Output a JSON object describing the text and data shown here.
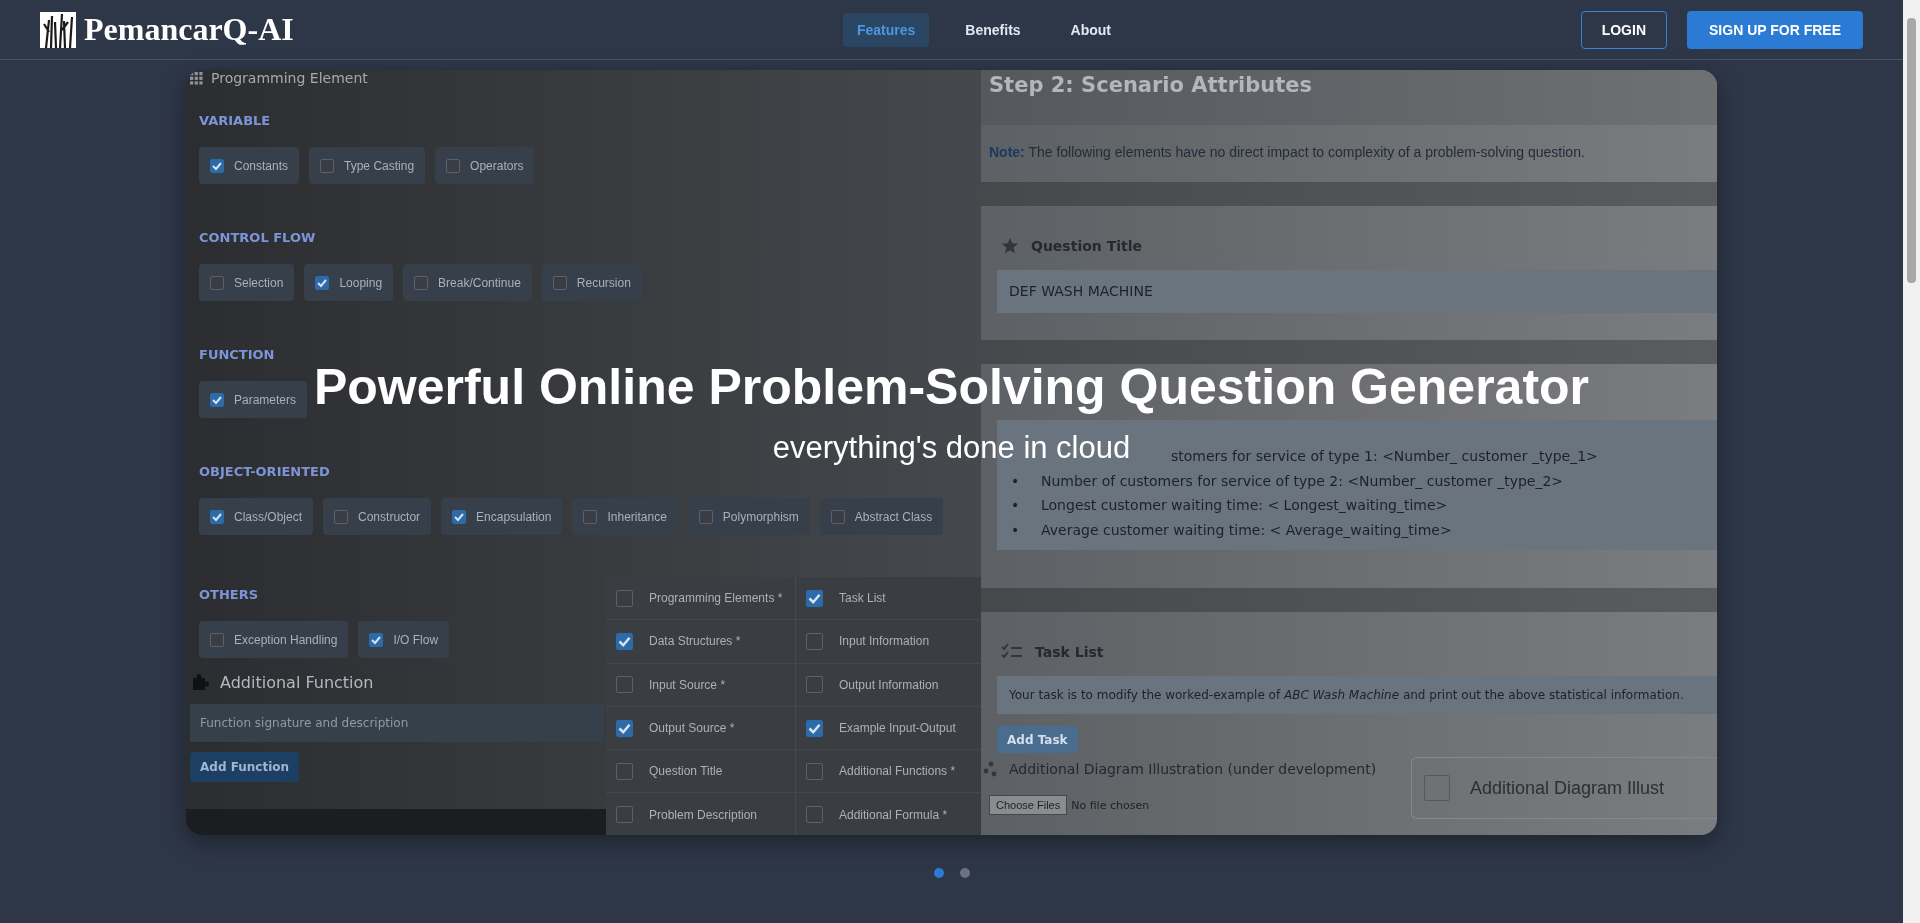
{
  "header": {
    "logo": "PemancarQ-AI",
    "nav": [
      {
        "label": "Features",
        "selected": true
      },
      {
        "label": "Benefits",
        "selected": false
      },
      {
        "label": "About",
        "selected": false
      }
    ],
    "buttons": [
      {
        "label": "LOGIN",
        "kind": "outline"
      },
      {
        "label": "SIGN UP FOR FREE",
        "kind": "primary"
      }
    ]
  },
  "hero": {
    "headline": "Powerful Online Problem-Solving Question Generator",
    "subtitle": "everything's done in cloud",
    "slides": [
      {
        "selected": true
      },
      {
        "selected": false
      }
    ],
    "screenshot": {
      "left_panel": {
        "title": "Programming Element",
        "groups": [
          {
            "heading": "VARIABLE",
            "options": [
              {
                "label": "Constants",
                "checked": true
              },
              {
                "label": "Type Casting",
                "checked": false
              },
              {
                "label": "Operators",
                "checked": false
              }
            ]
          },
          {
            "heading": "CONTROL FLOW",
            "options": [
              {
                "label": "Selection",
                "checked": false
              },
              {
                "label": "Looping",
                "checked": true
              },
              {
                "label": "Break/Continue",
                "checked": false
              },
              {
                "label": "Recursion",
                "checked": false
              }
            ]
          },
          {
            "heading": "FUNCTION",
            "options": [
              {
                "label": "Parameters",
                "checked": true
              }
            ]
          },
          {
            "heading": "OBJECT-ORIENTED",
            "options": [
              {
                "label": "Class/Object",
                "checked": true
              },
              {
                "label": "Constructor",
                "checked": false
              },
              {
                "label": "Encapsulation",
                "checked": true
              },
              {
                "label": "Inheritance",
                "checked": false
              },
              {
                "label": "Polymorphism",
                "checked": false
              },
              {
                "label": "Abstract Class",
                "checked": false
              }
            ]
          },
          {
            "heading": "OTHERS",
            "options": [
              {
                "label": "Exception Handling",
                "checked": false
              },
              {
                "label": "I/O Flow",
                "checked": true
              }
            ]
          }
        ],
        "additional_function": {
          "heading": "Additional Function",
          "placeholder": "Function signature and description",
          "button": "Add Function"
        }
      },
      "checklist": [
        [
          {
            "label": "Programming Elements *",
            "checked": false
          },
          {
            "label": "Data Structures *",
            "checked": true
          },
          {
            "label": "Input Source *",
            "checked": false
          },
          {
            "label": "Output Source *",
            "checked": true
          },
          {
            "label": "Question Title",
            "checked": false
          },
          {
            "label": "Problem Description",
            "checked": false
          }
        ],
        [
          {
            "label": "Task List",
            "checked": true
          },
          {
            "label": "Input Information",
            "checked": false
          },
          {
            "label": "Output Information",
            "checked": false
          },
          {
            "label": "Example Input-Output",
            "checked": true
          },
          {
            "label": "Additional Functions *",
            "checked": false
          },
          {
            "label": "Additional Formula *",
            "checked": false
          }
        ]
      ],
      "right_panel": {
        "title": "Step 2: Scenario Attributes",
        "note": "**Note:** The following elements have no direct impact to complexity of a problem-solving question.",
        "sections": [
          {
            "kind": "field",
            "heading": "Question Title",
            "value": "DEF WASH MACHINE"
          },
          {
            "kind": "list",
            "bullet": "•",
            "items": [
              {
                "text": "stomers for service of type 1: <Number_ customer _type_1>",
                "covered": true
              },
              {
                "text": "Number of customers for service of type 2: <Number_ customer _type_2>",
                "covered": false
              },
              {
                "text": "Longest customer waiting time: < Longest_waiting_time>",
                "covered": false
              },
              {
                "text": "Average customer waiting time: < Average_waiting_time>",
                "covered": false
              }
            ]
          },
          {
            "kind": "task",
            "heading": "Task List",
            "value": "Your task is to modify the worked-example of *ABC Wash Machine* and print out the above statistical information.",
            "button": "Add Task"
          }
        ],
        "diagram": {
          "heading": "Additional Diagram Illustration (under development)",
          "file_button": "Choose Files",
          "file_status": "No file chosen",
          "option": {
            "label": "Additional Diagram Illust",
            "checked": false
          }
        }
      }
    }
  }
}
